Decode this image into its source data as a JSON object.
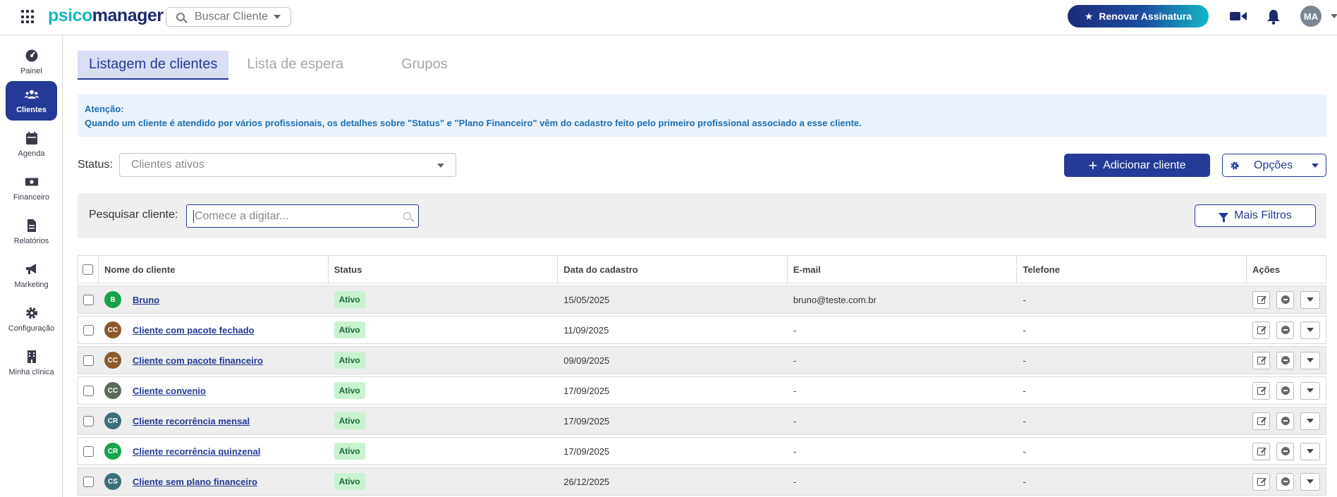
{
  "header": {
    "logo_part1": "psico",
    "logo_part2": "manager",
    "search_label": "Buscar Cliente",
    "renew_label": "Renovar Assinatura",
    "avatar_initials": "MA"
  },
  "sidebar": {
    "items": [
      {
        "label": "Painel",
        "icon": "dashboard-icon"
      },
      {
        "label": "Clientes",
        "icon": "users-icon"
      },
      {
        "label": "Agenda",
        "icon": "calendar-icon"
      },
      {
        "label": "Financeiro",
        "icon": "money-icon"
      },
      {
        "label": "Relatórios",
        "icon": "report-icon"
      },
      {
        "label": "Marketing",
        "icon": "megaphone-icon"
      },
      {
        "label": "Configuração",
        "icon": "gear-icon"
      },
      {
        "label": "Minha clínica",
        "icon": "building-icon"
      }
    ],
    "active_index": 1
  },
  "tabs": [
    "Listagem de clientes",
    "Lista de espera",
    "Grupos"
  ],
  "alert": {
    "title": "Atenção:",
    "message": "Quando um cliente é atendido por vários profissionais, os detalhes sobre \"Status\" e \"Plano Financeiro\" vêm do cadastro feito pelo primeiro profissional associado a esse cliente."
  },
  "status_filter": {
    "label": "Status:",
    "value": "Clientes ativos"
  },
  "actions": {
    "add_client": "Adicionar cliente",
    "options": "Opções",
    "more_filters": "Mais Filtros"
  },
  "search_client": {
    "label": "Pesquisar cliente:",
    "placeholder": "Comece a digitar..."
  },
  "table": {
    "columns": [
      "Nome do cliente",
      "Status",
      "Data do cadastro",
      "E-mail",
      "Telefone",
      "Ações"
    ],
    "rows": [
      {
        "initials": "B",
        "avatar_color": "#16a34a",
        "name": "Bruno",
        "status": "Ativo",
        "date": "15/05/2025",
        "email": "bruno@teste.com.br",
        "phone": "-"
      },
      {
        "initials": "CC",
        "avatar_color": "#8b5a2b",
        "name": "Cliente com pacote fechado",
        "status": "Ativo",
        "date": "11/09/2025",
        "email": "-",
        "phone": "-"
      },
      {
        "initials": "CC",
        "avatar_color": "#8b5a2b",
        "name": "Cliente com pacote financeiro",
        "status": "Ativo",
        "date": "09/09/2025",
        "email": "-",
        "phone": "-"
      },
      {
        "initials": "CC",
        "avatar_color": "#5b6b5b",
        "name": "Cliente convenio",
        "status": "Ativo",
        "date": "17/09/2025",
        "email": "-",
        "phone": "-"
      },
      {
        "initials": "CR",
        "avatar_color": "#3b6f7a",
        "name": "Cliente recorrência mensal",
        "status": "Ativo",
        "date": "17/09/2025",
        "email": "-",
        "phone": "-"
      },
      {
        "initials": "CR",
        "avatar_color": "#16a34a",
        "name": "Cliente recorrência quinzenal",
        "status": "Ativo",
        "date": "17/09/2025",
        "email": "-",
        "phone": "-"
      },
      {
        "initials": "CS",
        "avatar_color": "#3b6f7a",
        "name": "Cliente sem plano financeiro",
        "status": "Ativo",
        "date": "26/12/2025",
        "email": "-",
        "phone": "-"
      }
    ]
  },
  "colors": {
    "primary": "#243a96",
    "accent": "#14b8c4",
    "alert_bg": "#eaf3fc",
    "badge_bg": "#c9f3d0"
  }
}
